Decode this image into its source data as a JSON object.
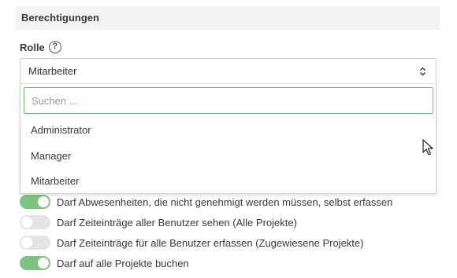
{
  "section": {
    "title": "Berechtigungen"
  },
  "role": {
    "label": "Rolle",
    "help_icon": "question-circle-icon",
    "selected": "Mitarbeiter",
    "caret_icon": "up-down-caret-icon"
  },
  "dropdown": {
    "search_placeholder": "Suchen ...",
    "options": [
      "Administrator",
      "Manager",
      "Mitarbeiter"
    ]
  },
  "permissions": [
    {
      "label": "Darf Abwesenheiten, die nicht genehmigt werden müssen, selbst erfassen",
      "enabled": true
    },
    {
      "label": "Darf Zeiteinträge aller Benutzer sehen (Alle Projekte)",
      "enabled": false
    },
    {
      "label": "Darf Zeiteinträge für alle Benutzer erfassen (Zugewiesene Projekte)",
      "enabled": false
    },
    {
      "label": "Darf auf alle Projekte buchen",
      "enabled": true
    }
  ],
  "colors": {
    "toggle_on": "#7cc47f",
    "toggle_off": "#e4e4e4",
    "search_focus": "#67c26e"
  }
}
